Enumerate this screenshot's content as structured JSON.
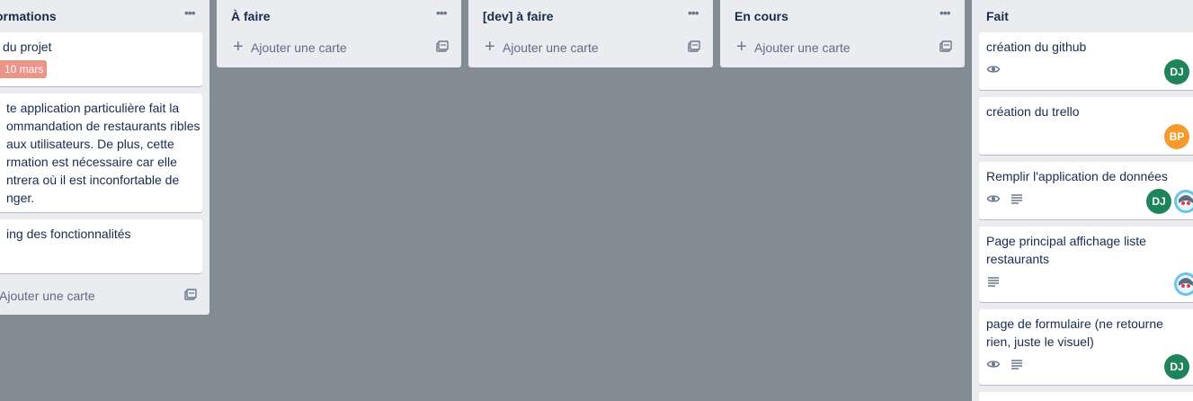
{
  "lists": [
    {
      "title": "ormations",
      "cards": [
        {
          "title": "du projet",
          "due": "10 mars"
        },
        {
          "title": "te application particulière fait la ommandation de restaurants ribles aux utilisateurs. De plus, cette rmation est nécessaire car elle ntrera où il est inconfortable de nger."
        },
        {
          "title": "ing des fonctionnalités"
        }
      ],
      "add_label": "Ajouter une carte"
    },
    {
      "title": "À faire",
      "add_label": "Ajouter une carte"
    },
    {
      "title": "[dev] à faire",
      "add_label": "Ajouter une carte"
    },
    {
      "title": "En cours",
      "add_label": "Ajouter une carte"
    },
    {
      "title": "Fait",
      "cards": [
        {
          "title": "création du github",
          "members": [
            "DJ"
          ]
        },
        {
          "title": "création du trello",
          "members": [
            "BP"
          ]
        },
        {
          "title": "Remplir l'application de données",
          "members": [
            "DJ"
          ]
        },
        {
          "title": "Page principal affichage liste restaurants"
        },
        {
          "title": "page de formulaire (ne retourne rien, juste le visuel)",
          "members": [
            "DJ"
          ]
        }
      ]
    }
  ],
  "colors": {
    "board_bg": "#838c91",
    "list_bg": "#ebecf0",
    "due_badge": "#ec9488",
    "avatar_dj": "#1f845a",
    "avatar_bp": "#f69a2e"
  },
  "icons": {
    "menu": "more-horizontal-icon",
    "add": "plus-icon",
    "template": "card-template-icon",
    "watch": "eye-icon",
    "description": "description-icon",
    "user_photo": "user-photo-avatar"
  }
}
